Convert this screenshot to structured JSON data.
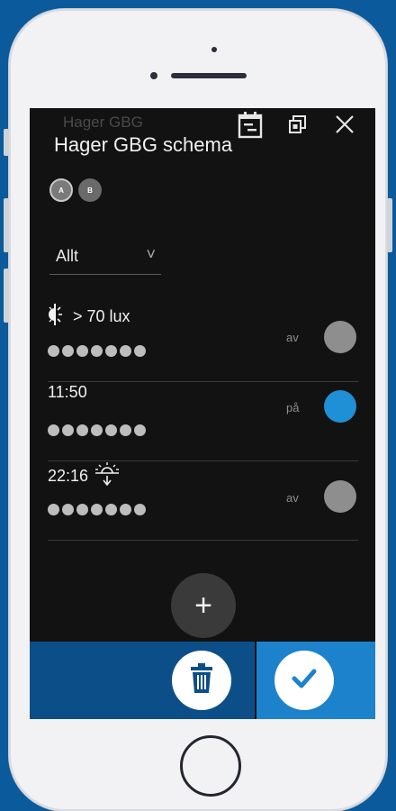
{
  "app": {
    "background_title": "Hager GBG",
    "title": "Hager GBG schema"
  },
  "tags": [
    "A",
    "B"
  ],
  "filter": {
    "label": "Allt",
    "chevron": "˅"
  },
  "rows": [
    {
      "type": "lux",
      "icon": "light-sensor-icon",
      "label": "> 70 lux",
      "state": "av",
      "on": false
    },
    {
      "type": "time",
      "icon": null,
      "label": "11:50",
      "state": "på",
      "on": true
    },
    {
      "type": "sunset",
      "icon": "sunset-icon",
      "label": "22:16",
      "state": "av",
      "on": false
    }
  ],
  "fab_label": "+",
  "colors": {
    "accent_blue": "#1f8fd6",
    "bar_dark": "#0c4e88",
    "bar_light": "#1c82cc",
    "screen_bg": "#121212"
  }
}
